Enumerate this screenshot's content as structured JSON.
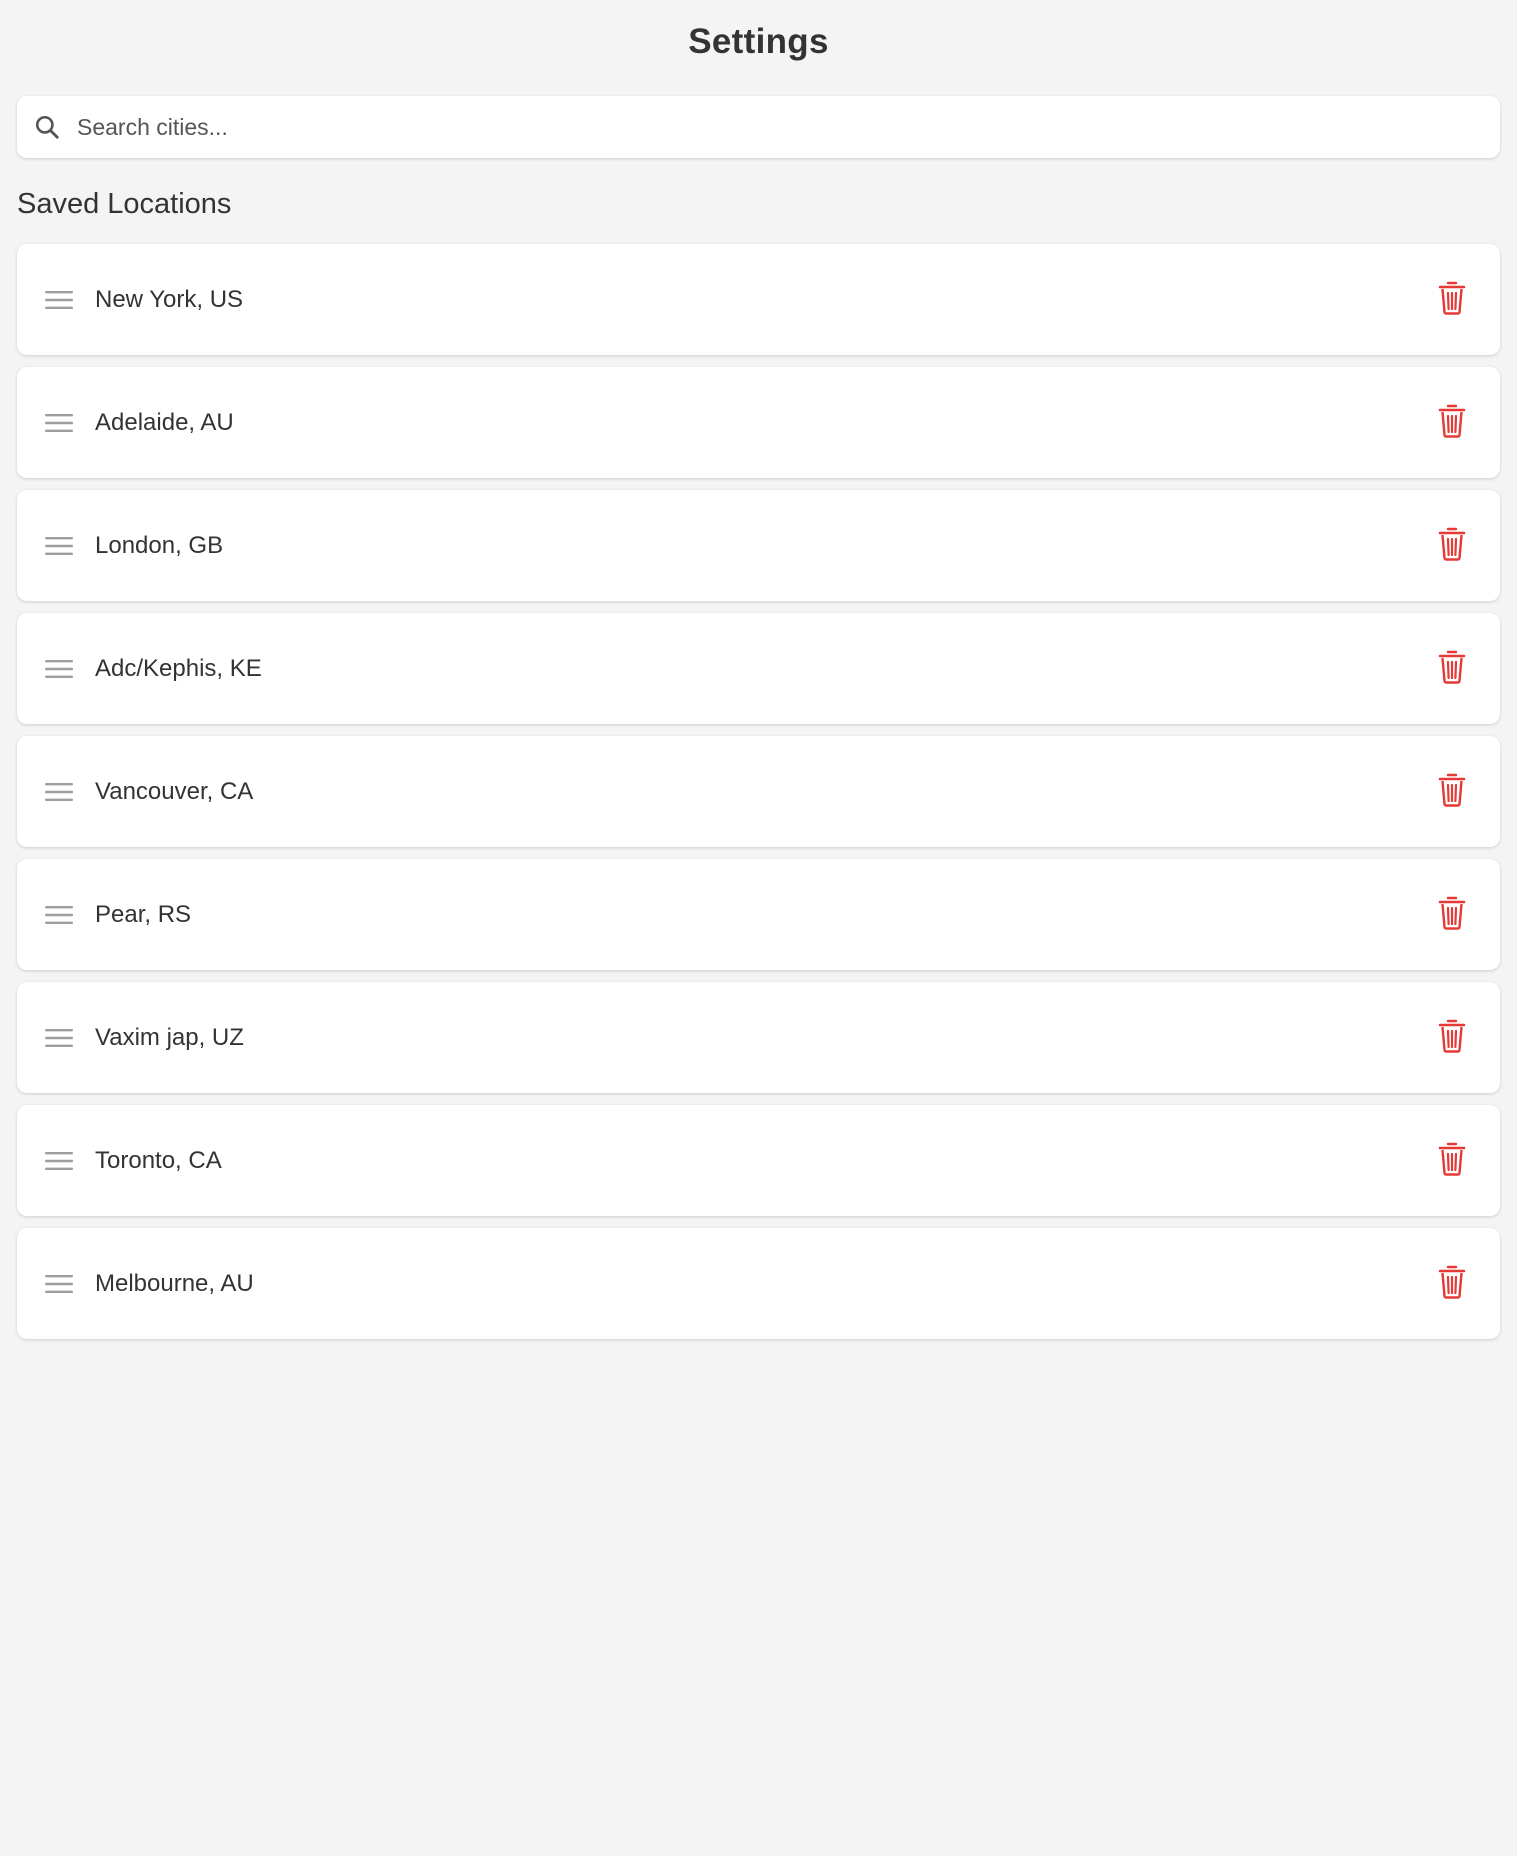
{
  "header": {
    "title": "Settings"
  },
  "search": {
    "placeholder": "Search cities...",
    "value": "",
    "icon": "search-icon"
  },
  "saved_locations": {
    "title": "Saved Locations",
    "items": [
      {
        "label": "New York, US"
      },
      {
        "label": "Adelaide, AU"
      },
      {
        "label": "London, GB"
      },
      {
        "label": "Adc/Kephis, KE"
      },
      {
        "label": "Vancouver, CA"
      },
      {
        "label": "Pear, RS"
      },
      {
        "label": "Vaxim jap, UZ"
      },
      {
        "label": "Toronto, CA"
      },
      {
        "label": "Melbourne, AU"
      }
    ],
    "drag_icon": "drag-handle-icon",
    "delete_icon": "trash-icon"
  },
  "colors": {
    "background": "#f4f4f4",
    "card": "#ffffff",
    "text": "#333333",
    "delete": "#e53935",
    "handle": "#9e9e9e",
    "search_icon": "#555555"
  }
}
